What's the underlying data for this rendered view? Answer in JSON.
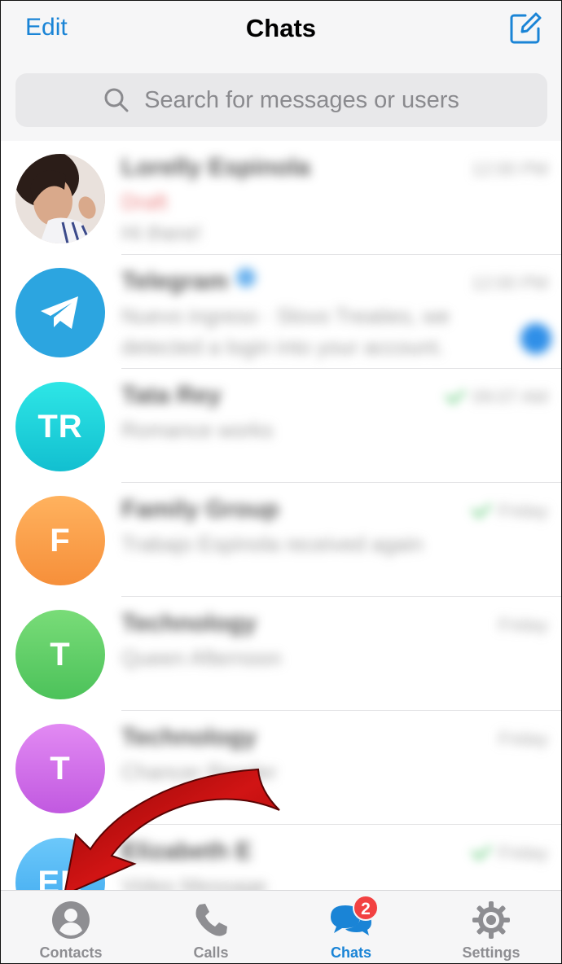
{
  "header": {
    "edit_label": "Edit",
    "title": "Chats",
    "compose_icon": "compose-icon"
  },
  "search": {
    "placeholder": "Search for messages or users",
    "icon": "search-icon"
  },
  "chats": [
    {
      "initials": "",
      "avatar_type": "photo",
      "color": "#c9a58f",
      "name": "Lorelly Espinola",
      "time": "12:00 PM",
      "message": "Draft",
      "message2": "Hi there!",
      "status": "none"
    },
    {
      "initials": "",
      "avatar_type": "telegram",
      "color": "#2ca5e0",
      "name": "Telegram",
      "time": "12:00 PM",
      "message": "Nuevo ingreso · Slovo Treaties, we",
      "message2": "detected a login into your account.",
      "status": "unread"
    },
    {
      "initials": "TR",
      "avatar_type": "initials",
      "color": "#1fd2d8",
      "name": "Tata Rey",
      "time": "09:07 AM",
      "message": "Romance works",
      "message2": "",
      "status": "read"
    },
    {
      "initials": "F",
      "avatar_type": "initials",
      "color": "#fda04b",
      "name": "Family Group",
      "time": "Friday",
      "message": "Trabajo Espinola received again",
      "message2": "",
      "status": "read"
    },
    {
      "initials": "T",
      "avatar_type": "initials",
      "color": "#5fcf63",
      "name": "Technology",
      "time": "Friday",
      "message": "Queen Afternoon",
      "message2": "",
      "status": "none"
    },
    {
      "initials": "T",
      "avatar_type": "initials",
      "color": "#cf66e6",
      "name": "Technology",
      "time": "Friday",
      "message": "Chancer Reader",
      "message2": "",
      "status": "none"
    },
    {
      "initials": "EE",
      "avatar_type": "initials",
      "color": "#4fb6f2",
      "name": "Elizabeth E",
      "time": "Friday",
      "message": "Video Message",
      "message2": "",
      "status": "read"
    }
  ],
  "tabs": [
    {
      "label": "Contacts",
      "icon": "person-circle-icon",
      "active": false
    },
    {
      "label": "Calls",
      "icon": "phone-icon",
      "active": false
    },
    {
      "label": "Chats",
      "icon": "chat-bubbles-icon",
      "active": true,
      "badge": "2"
    },
    {
      "label": "Settings",
      "icon": "gear-icon",
      "active": false
    }
  ],
  "annotation": {
    "type": "red-curved-arrow",
    "points_to": "Contacts tab"
  },
  "colors": {
    "accent": "#1a84d6",
    "badge": "#f24141",
    "arrow": "#b50c0c"
  }
}
